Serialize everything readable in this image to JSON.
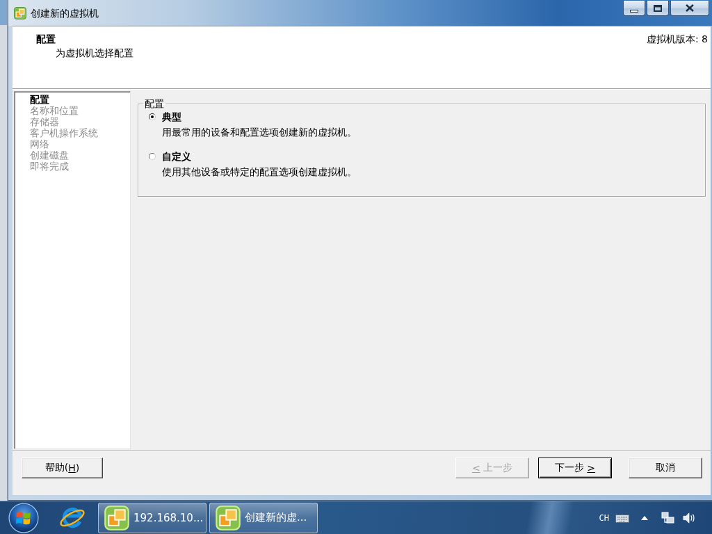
{
  "window": {
    "title": "创建新的虚拟机"
  },
  "header": {
    "title": "配置",
    "subtitle": "为虚拟机选择配置",
    "version": "虚拟机版本: 8"
  },
  "steps": [
    {
      "label": "配置",
      "selected": true
    },
    {
      "label": "名称和位置",
      "selected": false
    },
    {
      "label": "存储器",
      "selected": false
    },
    {
      "label": "客户机操作系统",
      "selected": false
    },
    {
      "label": "网络",
      "selected": false
    },
    {
      "label": "创建磁盘",
      "selected": false
    },
    {
      "label": "即将完成",
      "selected": false
    }
  ],
  "configuration": {
    "legend": "配置",
    "options": [
      {
        "label": "典型",
        "description": "用最常用的设备和配置选项创建新的虚拟机。",
        "selected": true
      },
      {
        "label": "自定义",
        "description": "使用其他设备或特定的配置选项创建虚拟机。",
        "selected": false
      }
    ]
  },
  "help_button": {
    "label_start": "帮助(",
    "mnemonic": "H",
    "label_end": ")",
    "disabled": false,
    "default": false
  },
  "nav_buttons": [
    {
      "mnemonic": "<",
      "label_end": " 上一步",
      "disabled": true,
      "default": false
    },
    {
      "label_start": "下一步 ",
      "mnemonic": ">",
      "disabled": false,
      "default": true
    },
    {
      "label_start": "取消",
      "disabled": false,
      "default": false
    }
  ],
  "taskbar": {
    "windows": [
      {
        "label": "192.168.10..."
      },
      {
        "label": "创建新的虚..."
      }
    ],
    "language": "CH"
  }
}
